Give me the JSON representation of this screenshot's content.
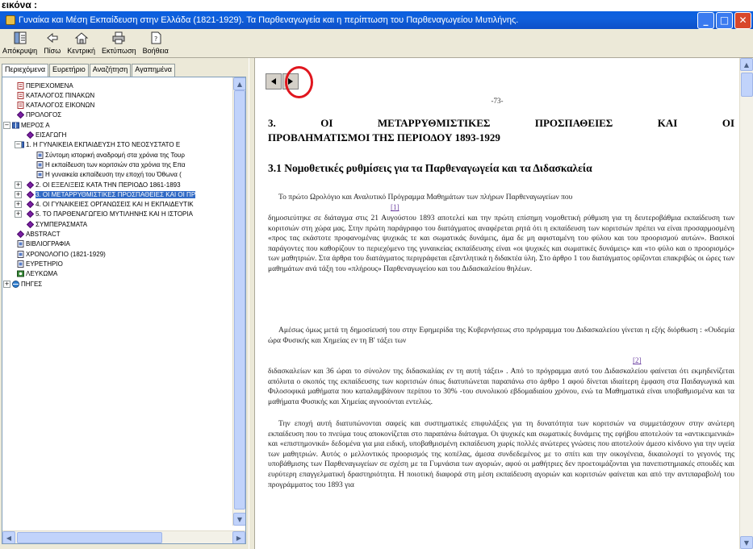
{
  "top_label": "εικόνα :",
  "window": {
    "title": "Γυναίκα και Μέση Εκπαίδευση στην Ελλάδα (1821-1929). Τα Παρθεναγωγεία και η περίπτωση του Παρθεναγωγείου Μυτιλήνης.",
    "minimize": "_",
    "maximize": "□",
    "close": "✕"
  },
  "toolbar": {
    "buttons": [
      {
        "label": "Απόκρυψη",
        "icon": "hide-panel-icon"
      },
      {
        "label": "Πίσω",
        "icon": "back-arrow-icon"
      },
      {
        "label": "Κεντρική",
        "icon": "home-icon"
      },
      {
        "label": "Εκτύπωση",
        "icon": "print-icon"
      },
      {
        "label": "Βοήθεια",
        "icon": "help-icon"
      }
    ]
  },
  "tabs": [
    "Περιεχόμενα",
    "Ευρετήριο",
    "Αναζήτηση",
    "Αγαπημένα"
  ],
  "tree": [
    {
      "label": "ΠΕΡΙΕΧΟΜΕΝΑ",
      "icon": "page-icon"
    },
    {
      "label": "ΚΑΤΑΛΟΓΟΣ ΠΙΝΑΚΩΝ",
      "icon": "page-icon"
    },
    {
      "label": "ΚΑΤΑΛΟΓΟΣ ΕΙΚΟΝΩΝ",
      "icon": "page-icon"
    },
    {
      "label": "ΠΡΟΛΟΓΟΣ",
      "icon": "diamond-icon"
    },
    {
      "label": "ΜΕΡΟΣ Α",
      "icon": "book-icon"
    },
    {
      "label": "ΕΙΣΑΓΩΓΗ",
      "icon": "diamond-icon"
    },
    {
      "label": "1. Η ΓΥΝΑΙΚΕΙΑ ΕΚΠΑΙΔΕΥΣΗ ΣΤΟ ΝΕΟΣΥΣΤΑΤΟ Ε",
      "icon": "book-icon"
    },
    {
      "label": "Σύντομη ιστορική αναδρομή στα χρόνια της Τουρ",
      "icon": "doc-icon"
    },
    {
      "label": "Η εκπαίδευση των κοριτσιών στα χρόνια της Επα",
      "icon": "doc-icon"
    },
    {
      "label": "Η γυναικεία εκπαίδευση την εποχή του Όθωνα (",
      "icon": "doc-icon"
    },
    {
      "label": "2. ΟΙ ΕΞΕΛΙΞΕΙΣ ΚΑΤΑ ΤΗΝ ΠΕΡΙΟΔΟ 1861-1893",
      "icon": "diamond-icon"
    },
    {
      "label": "3. ΟΙ ΜΕΤΑΡΡΥΘΜΙΣΤΙΚΕΣ ΠΡΟΣΠΑΘΕΙΕΣ ΚΑΙ ΟΙ ΠΡ",
      "icon": "diamond-icon"
    },
    {
      "label": "4. ΟΙ ΓΥΝΑΙΚΕΙΕΣ ΟΡΓΑΝΩΣΕΙΣ ΚΑΙ Η ΕΚΠΑΙΔΕΥΤΙΚ",
      "icon": "diamond-icon"
    },
    {
      "label": "5. ΤΟ ΠΑΡΘΕΝΑΓΩΓΕΙΟ ΜΥΤΙΛΗΝΗΣ ΚΑΙ Η ΙΣΤΟΡΙΑ",
      "icon": "diamond-icon"
    },
    {
      "label": "ΣΥΜΠΕΡΑΣΜΑΤΑ",
      "icon": "diamond-icon"
    },
    {
      "label": "ABSTRACT",
      "icon": "diamond-icon"
    },
    {
      "label": "ΒΙΒΛΙΟΓΡΑΦΙΑ",
      "icon": "doc-icon"
    },
    {
      "label": "ΧΡΟΝΟΛΟΓΙΟ (1821-1929)",
      "icon": "doc-icon"
    },
    {
      "label": "ΕΥΡΕΤΗΡΙΟ",
      "icon": "doc-icon"
    },
    {
      "label": "ΛΕΥΚΩΜΑ",
      "icon": "album-icon"
    },
    {
      "label": "ΠΗΓΕΣ",
      "icon": "globe-book-icon"
    }
  ],
  "tree_expanders": [
    "−",
    "−",
    "+",
    "+",
    "+",
    "+",
    "+"
  ],
  "content": {
    "page_number": "-73-",
    "heading_line1": [
      "3.",
      "ΟΙ",
      "ΜΕΤΑΡΡΥΘΜΙΣΤΙΚΕΣ",
      "ΠΡΟΣΠΑΘΕΙΕΣ",
      "ΚΑΙ",
      "ΟΙ"
    ],
    "heading_line2": "ΠΡΟΒΛΗΜΑΤΙΣΜΟΙ ΤΗΣ ΠΕΡΙΟΔΟΥ 1893-1929",
    "subheading": "3.1 Νομοθετικές ρυθμίσεις για τα Παρθεναγωγεία και τα Διδασκαλεία",
    "fn1": "[1]",
    "fn2": "[2]",
    "p1_line1": "Το πρώτο Ωρολόγιο και Αναλυτικό Πρόγραμμα Μαθημάτων των πλήρων Παρθεναγωγείων που",
    "p1_rest": "δημοσιεύτηκε σε διάταγμα      στις 21 Αυγούστου 1893 αποτελεί και την πρώτη επίσημη νομοθετική ρύθμιση για τη δευτεροβάθμια εκπαίδευση των κοριτσιών στη χώρα μας. Στην πρώτη παράγραφο του διατάγματος αναφέρεται ρητά ότι η εκπαίδευση των κοριτσιών πρέπει να είναι προσαρμοσμένη «προς τας εκάστοτε προφανομένας ψυχικάς τε και σωματικάς δυνάμεις, άμα δε μη αφισταμένη του φύλου και του προορισμού αυτών». Βασικοί παράγοντες που καθορίζουν το περιεχόμενο της γυναικείας εκπαίδευσης είναι «οι ψυχικές και σωματικές δυνάμεις» και «το φύλο και ο προορισμός» των μαθητριών. Στα άρθρα του διατάγματος περιγράφεται εξαντλητικά η διδακτέα ύλη. Στο άρθρο 1 του διατάγματος ορίζονται επακριβώς οι ώρες των μαθημάτων ανά τάξη του «πλήρους» Παρθεναγωγείου και του Διδασκαλείου θηλέων.",
    "p2_line": "Αμέσως όμως μετά τη δημοσίευσή του στην Εφημερίδα της Κυβερνήσεως στο πρόγραμμα του Διδασκαλείου γίνεται η εξής διόρθωση : «Ουδεμία ώρα Φυσικής και Χημείας εν τη Β' τάξει των",
    "p2_rest": "διδασκαλείων και 36 ώραι το σύνολον της διδασκαλίας εν τη αυτή τάξει»   . Από το πρόγραμμα αυτό του Διδασκαλείου φαίνεται ότι εκμηδενίζεται απόλυτα ο σκοπός της εκπαίδευσης των κοριτσιών όπως διατυπώνεται παραπάνω στο άρθρο 1 αφού δίνεται ιδιαίτερη έμφαση στα Παιδαγωγικά και Φιλοσοφικά μαθήματα που καταλαμβάνουν περίπου το 30% -του συνολικού εβδομαδιαίου χρόνου, ενώ τα Μαθηματικά είναι υποβαθμισμένα και τα μαθήματα Φυσικής και Χημείας αγνοούνται εντελώς.",
    "p3": "Την εποχή αυτή διατυπώνονται σαφείς και συστηματικές επιφυλάξεις για τη δυνατότητα των κοριτσιών να συμμετάσχουν στην ανώτερη εκπαίδευση που το πνεύμα τους αποκονίζεται στο παραπάνω διάταγμα. Οι ψυχικές και σωματικές δυνάμεις της εφήβου αποτελούν τα «αντικειμενικά» και «επιστημονικά» δεδομένα για μια ειδική, υποβαθμισμένη εκπαίδευση χωρίς πολλές ανώτερες γνώσεις που αποτελούν άμεσο κίνδυνο για την υγεία των μαθητριών. Αυτός ο μελλοντικός προορισμός της κοπέλας, άμεσα συνδεδεμένος με το σπίτι και την οικογένεια, δικαιολογεί το γεγονός της υποβάθμισης των Παρθεναγωγείων σε σχέση με τα Γυμνάσια των αγοριών, αφού οι μαθήτριες δεν προετοιμάζονται για πανεπιστημιακές σπουδές και ευρύτερη επαγγελματική δραστηριότητα. Η ποιοτική διαφορά στη μέση εκπαίδευση αγοριών και κοριτσιών φαίνεται και από την αντιπαραβολή του προγράμματος του 1893 για"
  }
}
